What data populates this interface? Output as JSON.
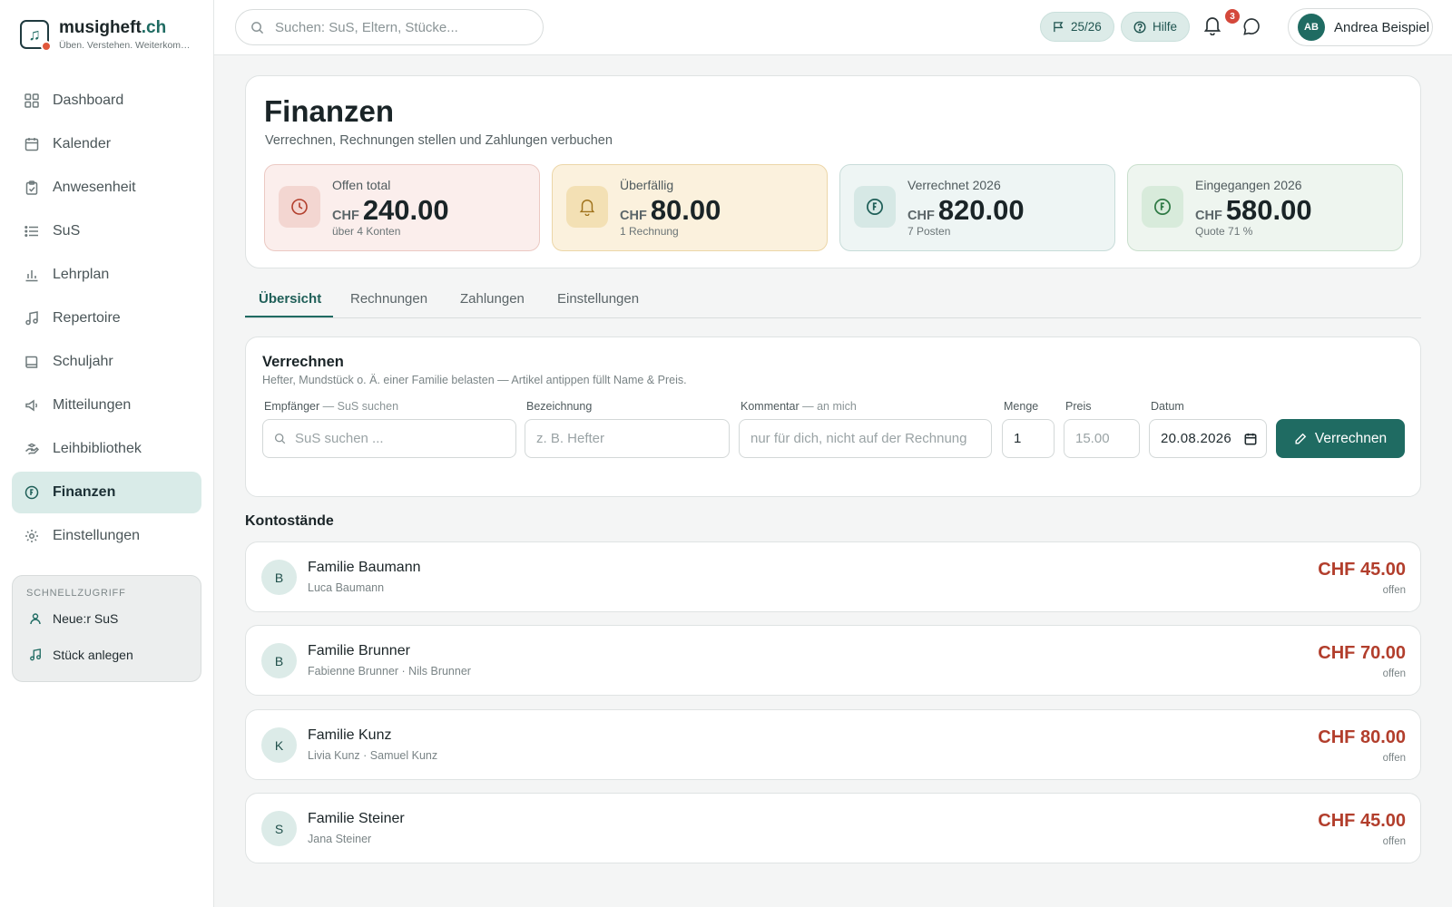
{
  "brand": {
    "name": "musigheft",
    "tld": ".ch",
    "tagline": "Üben. Verstehen. Weiterkommen."
  },
  "sidebar": {
    "items": [
      {
        "label": "Dashboard",
        "icon": "grid-icon"
      },
      {
        "label": "Kalender",
        "icon": "calendar-icon"
      },
      {
        "label": "Anwesenheit",
        "icon": "clipboard-check-icon"
      },
      {
        "label": "SuS",
        "icon": "list-icon"
      },
      {
        "label": "Lehrplan",
        "icon": "bar-chart-icon"
      },
      {
        "label": "Repertoire",
        "icon": "music-note-icon"
      },
      {
        "label": "Schuljahr",
        "icon": "book-icon"
      },
      {
        "label": "Mitteilungen",
        "icon": "megaphone-icon"
      },
      {
        "label": "Leihbibliothek",
        "icon": "hand-icon"
      },
      {
        "label": "Finanzen",
        "icon": "coin-icon",
        "active": true
      },
      {
        "label": "Einstellungen",
        "icon": "gear-icon"
      }
    ],
    "quick": {
      "title": "SCHNELLZUGRIFF",
      "items": [
        {
          "label": "Neue:r SuS",
          "icon": "user-icon"
        },
        {
          "label": "Stück anlegen",
          "icon": "music-note-icon"
        }
      ]
    }
  },
  "topbar": {
    "search_placeholder": "Suchen: SuS, Eltern, Stücke...",
    "year_label": "25/26",
    "help_label": "Hilfe",
    "notification_count": "3",
    "user": {
      "initials": "AB",
      "name": "Andrea Beispiel"
    }
  },
  "page": {
    "title": "Finanzen",
    "subtitle": "Verrechnen, Rechnungen stellen und Zahlungen verbuchen"
  },
  "stats": [
    {
      "label": "Offen total",
      "currency": "CHF",
      "value": "240.00",
      "note": "über 4 Konten",
      "bg": "#fbeeec",
      "border": "#ebc9c3",
      "icon_bg": "#f3d6d1",
      "icon_color": "#b23e2c"
    },
    {
      "label": "Überfällig",
      "currency": "CHF",
      "value": "80.00",
      "note": "1 Rechnung",
      "bg": "#fbf1dd",
      "border": "#ecd6a8",
      "icon_bg": "#f3e0b4",
      "icon_color": "#a0731c"
    },
    {
      "label": "Verrechnet 2026",
      "currency": "CHF",
      "value": "820.00",
      "note": "7 Posten",
      "bg": "#eef5f4",
      "border": "#c8dcd9",
      "icon_bg": "#d6e8e5",
      "icon_color": "#1f5f58"
    },
    {
      "label": "Eingegangen 2026",
      "currency": "CHF",
      "value": "580.00",
      "note": "Quote 71 %",
      "bg": "#eef5ef",
      "border": "#c9dfcc",
      "icon_bg": "#d8ebdb",
      "icon_color": "#2f7a45"
    }
  ],
  "tabs": [
    "Übersicht",
    "Rechnungen",
    "Zahlungen",
    "Einstellungen"
  ],
  "charge": {
    "title": "Verrechnen",
    "subtitle": "Hefter, Mundstück o. Ä. einer Familie belasten — Artikel antippen füllt Name & Preis.",
    "recipient_label": "Empfänger",
    "recipient_hint": "— SuS suchen",
    "recipient_placeholder": "SuS suchen ...",
    "desc_label": "Bezeichnung",
    "desc_placeholder": "z. B. Hefter",
    "comment_label": "Kommentar",
    "comment_hint": "— an mich",
    "comment_placeholder": "nur für dich, nicht auf der Rechnung",
    "qty_label": "Menge",
    "qty_value": "1",
    "price_label": "Preis",
    "price_placeholder": "15.00",
    "date_label": "Datum",
    "date_value": "20.08.2026",
    "button_label": "Verrechnen"
  },
  "accounts": {
    "title": "Kontostände",
    "items": [
      {
        "initial": "B",
        "name": "Familie Baumann",
        "members": "Luca Baumann",
        "amount": "CHF 45.00",
        "status": "offen"
      },
      {
        "initial": "B",
        "name": "Familie Brunner",
        "members": "Fabienne Brunner · Nils Brunner",
        "amount": "CHF 70.00",
        "status": "offen"
      },
      {
        "initial": "K",
        "name": "Familie Kunz",
        "members": "Livia Kunz · Samuel Kunz",
        "amount": "CHF 80.00",
        "status": "offen"
      },
      {
        "initial": "S",
        "name": "Familie Steiner",
        "members": "Jana Steiner",
        "amount": "CHF 45.00",
        "status": "offen"
      }
    ]
  }
}
